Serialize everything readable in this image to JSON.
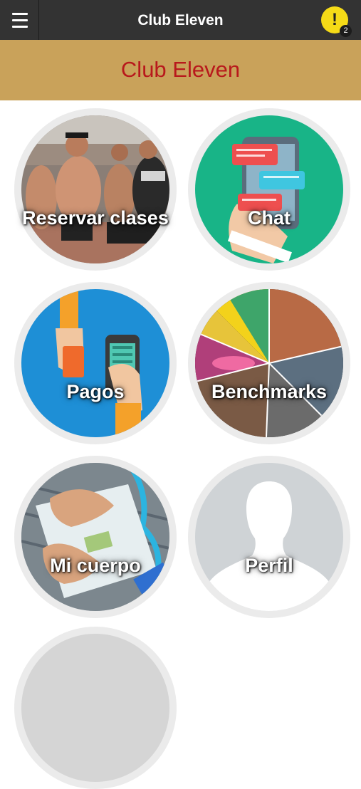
{
  "header": {
    "title": "Club Eleven",
    "notification_count": "2",
    "notification_symbol": "!",
    "notification_color": "#f5db17"
  },
  "banner": {
    "title": "Club Eleven",
    "background": "#c9a25a",
    "text_color": "#b8191c"
  },
  "tiles": [
    {
      "label": "Reservar clases",
      "icon": "athletes-running-photo"
    },
    {
      "label": "Chat",
      "icon": "chat-bubbles-phone-icon"
    },
    {
      "label": "Pagos",
      "icon": "card-payment-terminal-icon"
    },
    {
      "label": "Benchmarks",
      "icon": "sports-collage-photo"
    },
    {
      "label": "Mi cuerpo",
      "icon": "bathroom-scale-photo"
    },
    {
      "label": "Perfil",
      "icon": "person-silhouette-icon"
    }
  ]
}
